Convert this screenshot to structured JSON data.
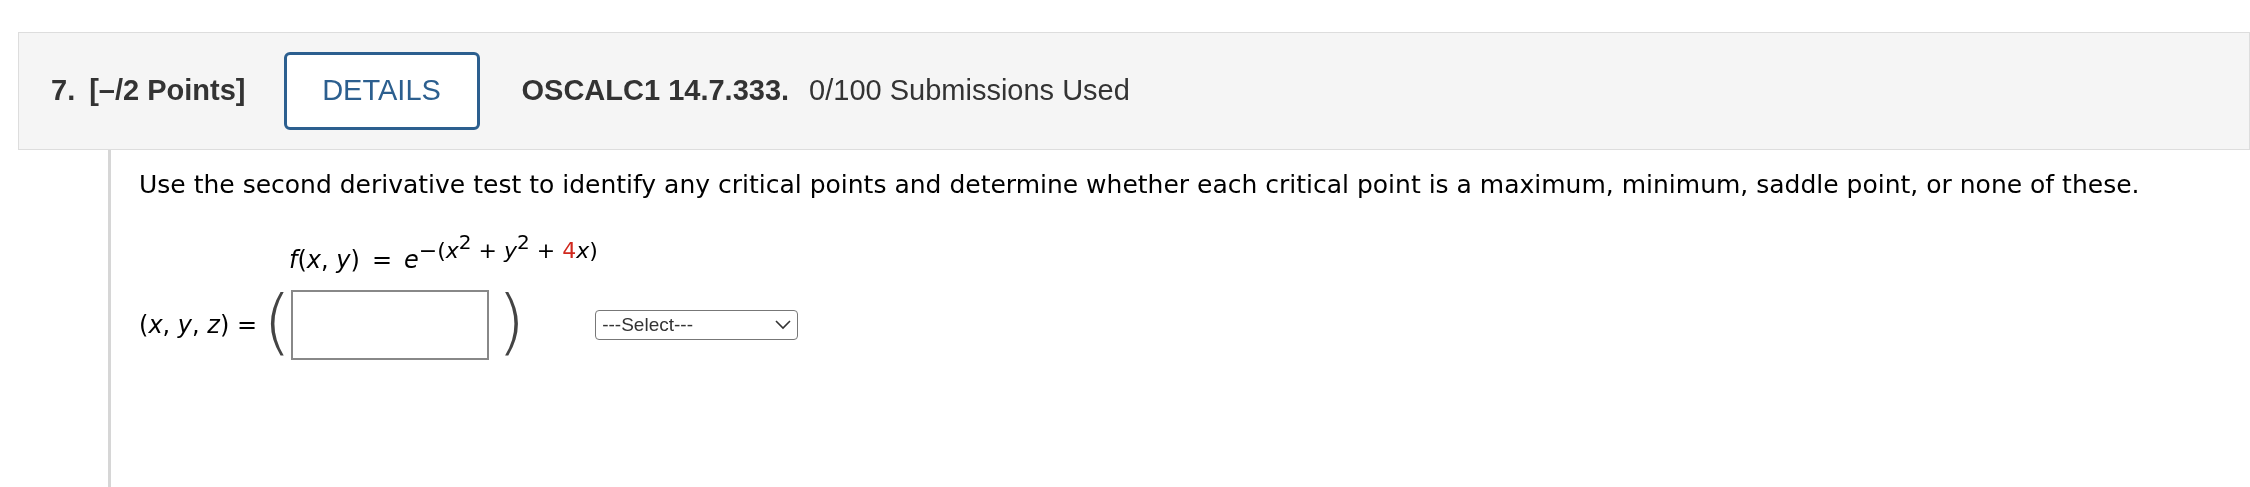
{
  "question": {
    "number": "7.",
    "points": "[–/2 Points]",
    "details_button": "DETAILS",
    "source": "OSCALC1 14.7.333.",
    "submissions": "0/100 Submissions Used"
  },
  "prompt": "Use the second derivative test to identify any critical points and determine whether each critical point is a maximum, minimum, saddle point, or none of these.",
  "formula": {
    "lhs": "*f*(*x*, *y*)",
    "equals": "=",
    "base": "*e*",
    "exponent": [
      {
        "kind": "text",
        "text": "−(*x*",
        "color": "#000000"
      },
      {
        "kind": "sup",
        "text": "2",
        "color": "#000000"
      },
      {
        "kind": "text",
        "text": " + *y*",
        "color": "#000000"
      },
      {
        "kind": "sup",
        "text": "2",
        "color": "#000000"
      },
      {
        "kind": "text",
        "text": " + ",
        "color": "#000000"
      },
      {
        "kind": "text",
        "text": "4",
        "color": "#d0281e"
      },
      {
        "kind": "text",
        "text": "*x*)",
        "color": "#000000"
      }
    ]
  },
  "answer": {
    "label": "(*x*, *y*, *z*) =",
    "open_paren": "(",
    "close_paren": ")",
    "select": "---Select---"
  }
}
